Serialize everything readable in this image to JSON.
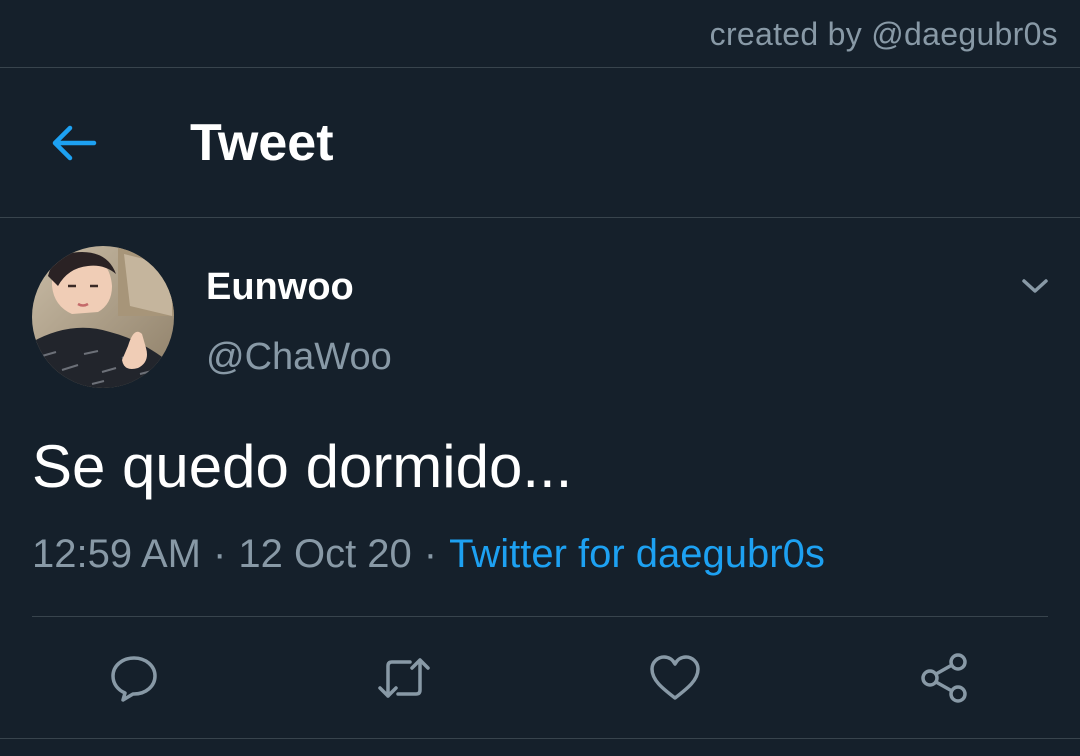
{
  "credit": "created by @daegubr0s",
  "header": {
    "title": "Tweet",
    "back_icon": "arrow-left-icon"
  },
  "tweet": {
    "display_name": "Eunwoo",
    "handle": "@ChaWoo",
    "text": "Se quedo dormido...",
    "time": "12:59 AM",
    "separator": "·",
    "date": "12 Oct 20",
    "source": "Twitter for daegubr0s"
  },
  "actions": [
    {
      "icon": "reply-icon"
    },
    {
      "icon": "retweet-icon"
    },
    {
      "icon": "like-icon"
    },
    {
      "icon": "share-icon"
    }
  ],
  "colors": {
    "background": "#15202b",
    "accent": "#1da1f2",
    "secondary_text": "#8899a6",
    "border": "#38444d"
  }
}
